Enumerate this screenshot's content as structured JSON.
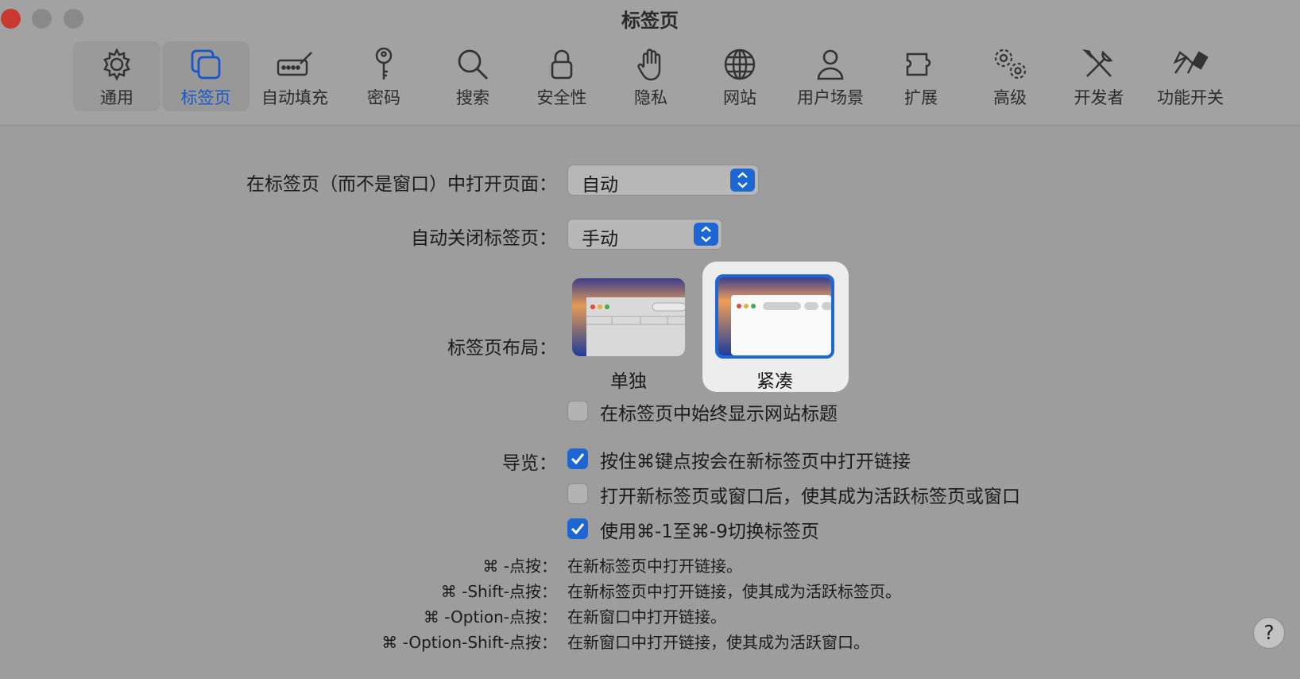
{
  "window": {
    "title": "标签页"
  },
  "toolbar": {
    "tabs": [
      {
        "label": "通用",
        "icon": "gear-icon"
      },
      {
        "label": "标签页",
        "icon": "tabs-icon",
        "active": true
      },
      {
        "label": "自动填充",
        "icon": "autofill-pen-icon"
      },
      {
        "label": "密码",
        "icon": "key-icon"
      },
      {
        "label": "搜索",
        "icon": "search-icon"
      },
      {
        "label": "安全性",
        "icon": "lock-icon"
      },
      {
        "label": "隐私",
        "icon": "hand-icon"
      },
      {
        "label": "网站",
        "icon": "globe-icon"
      },
      {
        "label": "用户场景",
        "icon": "person-icon"
      },
      {
        "label": "扩展",
        "icon": "puzzle-icon"
      },
      {
        "label": "高级",
        "icon": "gears-icon"
      },
      {
        "label": "开发者",
        "icon": "wrench-screwdriver-icon"
      },
      {
        "label": "功能开关",
        "icon": "flags-icon"
      }
    ]
  },
  "settings": {
    "open_pages_label": "在标签页（而不是窗口）中打开页面：",
    "open_pages_value": "自动",
    "auto_close_label": "自动关闭标签页：",
    "auto_close_value": "手动",
    "layout_label": "标签页布局：",
    "layout_options": [
      {
        "label": "单独",
        "selected": false
      },
      {
        "label": "紧凑",
        "selected": true
      }
    ],
    "always_show_title": {
      "label": "在标签页中始终显示网站标题",
      "checked": false
    },
    "navigation_label": "导览：",
    "navigation_options": [
      {
        "label": "按住⌘键点按会在新标签页中打开链接",
        "checked": true
      },
      {
        "label": "打开新标签页或窗口后，使其成为活跃标签页或窗口",
        "checked": false
      },
      {
        "label": "使用⌘-1至⌘-9切换标签页",
        "checked": true
      }
    ],
    "hints": [
      {
        "key": "⌘ -点按：",
        "value": "在新标签页中打开链接。"
      },
      {
        "key": "⌘ -Shift-点按：",
        "value": "在新标签页中打开链接，使其成为活跃标签页。"
      },
      {
        "key": "⌘ -Option-点按：",
        "value": "在新窗口中打开链接。"
      },
      {
        "key": "⌘ -Option-Shift-点按：",
        "value": "在新窗口中打开链接，使其成为活跃窗口。"
      }
    ]
  },
  "help": {
    "label": "?"
  },
  "colors": {
    "accent": "#1d67d5",
    "background": "#9d9d9d"
  }
}
